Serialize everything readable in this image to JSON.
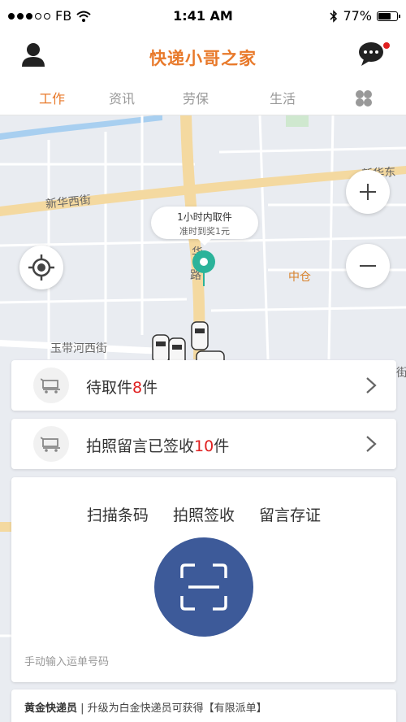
{
  "status_bar": {
    "carrier": "FB",
    "time": "1:41 AM",
    "battery_percent": "77%",
    "battery_level": 0.77
  },
  "header": {
    "title": "快递小哥之家",
    "has_unread_message": true
  },
  "tabs": [
    {
      "label": "工作",
      "active": true
    },
    {
      "label": "资讯",
      "active": false
    },
    {
      "label": "劳保",
      "active": false
    },
    {
      "label": "生活",
      "active": false
    }
  ],
  "map": {
    "streets": [
      "新华西街",
      "新华东街",
      "玉带河西街",
      "华",
      "路",
      "中仓",
      "街"
    ],
    "bubble": {
      "line1": "1小时内取件",
      "line2": "准时到奖1元"
    }
  },
  "cards": {
    "pickup": {
      "prefix": "待取件",
      "count": "8",
      "suffix": "件"
    },
    "signed": {
      "prefix": "拍照留言已签收",
      "count": "10",
      "suffix": "件"
    }
  },
  "scan": {
    "options": [
      "扫描条码",
      "拍照签收",
      "留言存证"
    ],
    "manual_input": "手动输入运单号码"
  },
  "promo": {
    "level": "黄金快递员",
    "text": " | 升级为白金快递员可获得【有限派单】"
  },
  "colors": {
    "accent": "#e8792a",
    "scan_button": "#3d5a99",
    "count_highlight": "#e02020",
    "pin": "#2bb39a"
  }
}
